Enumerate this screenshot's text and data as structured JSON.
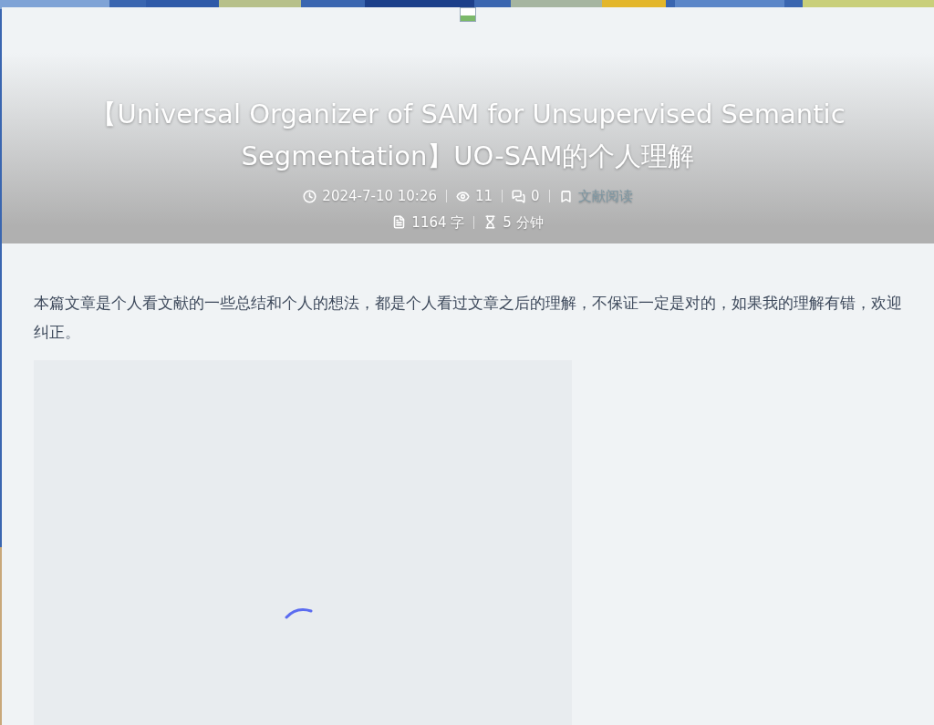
{
  "post": {
    "title": "【Universal Organizer of SAM for Unsupervised Semantic Segmentation】UO-SAM的个人理解",
    "meta_rows": [
      [
        {
          "kind": "date",
          "text": "2024-7-10 10:26"
        },
        {
          "kind": "views",
          "text": "11"
        },
        {
          "kind": "comments",
          "text": "0"
        },
        {
          "kind": "category",
          "text": "文献阅读"
        }
      ],
      [
        {
          "kind": "words",
          "text": "1164 字"
        },
        {
          "kind": "time",
          "text": "5 分钟"
        }
      ]
    ]
  },
  "content": {
    "intro": "本篇文章是个人看文献的一些总结和个人的想法，都是个人看过文章之后的理解，不保证一定是对的，如果我的理解有错，欢迎纠正。",
    "figure": {
      "kind": "loading"
    }
  }
}
